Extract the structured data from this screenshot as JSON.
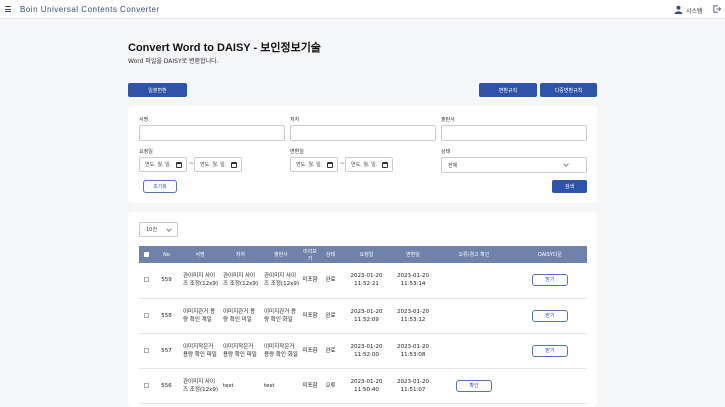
{
  "header": {
    "app_title": "Boin Universal Contents Converter",
    "user_name": "시스템"
  },
  "page": {
    "title": "Convert Word to DAISY - 보인정보기술",
    "description": "Word 파일을 DAISY로 변환합니다."
  },
  "toolbar": {
    "single_convert": "일괄변환",
    "convert_rules": "변환규칙",
    "multi_convert": "다중변환규칙"
  },
  "search": {
    "title_label": "서명",
    "author_label": "저자",
    "publisher_label": "출판사",
    "request_date_label": "요청일",
    "convert_date_label": "변환일",
    "status_label": "상태",
    "date_placeholder": "연도. 월. 일.",
    "tilde": "~",
    "status_value": "전체",
    "reset": "초기화",
    "submit": "검색"
  },
  "list": {
    "page_size": "10건",
    "columns": [
      "No",
      "서명",
      "저자",
      "출판사",
      "미리보기",
      "상태",
      "요청일",
      "변환일",
      "오류/경고 확인",
      "DAISY다운"
    ],
    "rows": [
      {
        "no": "559",
        "title": "관이미지 사이즈 조정(12x9)",
        "author": "관이미지 사이즈 조정(12x9)",
        "publisher": "관이미지 사이즈 조정(12x9)",
        "preview": "미포함",
        "status": "완료",
        "requested": "2023-01-20 11:52:21",
        "converted": "2023-01-20 11:53:14",
        "error_btn": "",
        "download_btn": "받기"
      },
      {
        "no": "558",
        "title": "이미지관거 용량 확인 계일",
        "author": "이미지관거 용량 확인 미일",
        "publisher": "이미지관거 용량 확인 화일",
        "preview": "미포함",
        "status": "완료",
        "requested": "2023-01-20 11:52:09",
        "converted": "2023-01-20 11:53:12",
        "error_btn": "",
        "download_btn": "받기"
      },
      {
        "no": "557",
        "title": "이미지작은거 용량 확인 파일",
        "author": "이미지작은거 용량 확인 파일",
        "publisher": "이미지작은거 용량 확인 화일",
        "preview": "미포함",
        "status": "완료",
        "requested": "2023-01-20 11:52:00",
        "converted": "2023-01-20 11:53:08",
        "error_btn": "",
        "download_btn": "받기"
      },
      {
        "no": "556",
        "title": "관이미지 사이즈 조정(12x9)",
        "author": "test",
        "publisher": "test",
        "preview": "미포함",
        "status": "오류",
        "requested": "2023-01-20 11:50:40",
        "converted": "2023-01-20 11:51:07",
        "error_btn": "확인",
        "download_btn": ""
      }
    ]
  }
}
